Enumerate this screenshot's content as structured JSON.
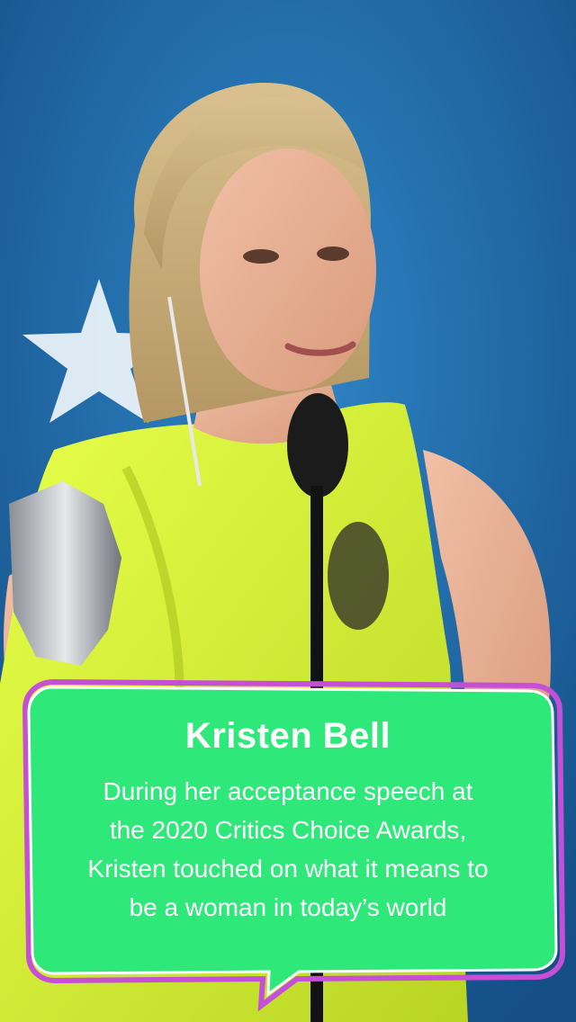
{
  "caption": {
    "title": "Kristen Bell",
    "body_lines": [
      "During her acceptance speech at",
      "the 2020 Critics Choice Awards,",
      "Kristen touched on what it means to",
      "be a woman in today’s world"
    ]
  },
  "colors": {
    "backdrop": "#1f6fae",
    "dress": "#d8f03a",
    "bubble_fill": "#2ee87a",
    "bubble_outline": "#c64fd8"
  }
}
